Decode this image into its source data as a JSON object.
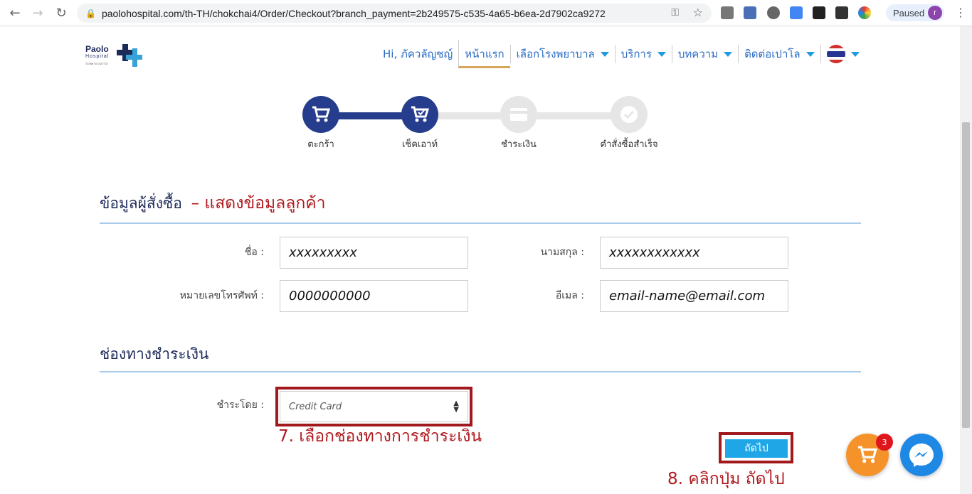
{
  "browser": {
    "url": "paolohospital.com/th-TH/chokchai4/Order/Checkout?branch_payment=2b249575-c535-4a65-b6ea-2d7902ca9272",
    "profile_status": "Paused",
    "profile_initial": "r"
  },
  "logo": {
    "line1": "Paolo",
    "line2": "Hospital",
    "line3": "โรงพยาบาลเปาโล"
  },
  "nav": {
    "greeting": "Hi, ภัควลัญชญ์",
    "home": "หน้าแรก",
    "hospital": "เลือกโรงพยาบาล",
    "services": "บริการ",
    "articles": "บทความ",
    "contact": "ติดต่อเปาโล"
  },
  "steps": [
    {
      "label": "ตะกร้า",
      "state": "done"
    },
    {
      "label": "เช็คเอาท์",
      "state": "current"
    },
    {
      "label": "ชำระเงิน",
      "state": "pending"
    },
    {
      "label": "คำสั่งซื้อสำเร็จ",
      "state": "pending"
    }
  ],
  "buyer_section": {
    "title": "ข้อมูลผู้สั่งซื้อ",
    "annotation": "– แสดงข้อมูลลูกค้า",
    "first_name_label": "ชื่อ :",
    "first_name_value": "xxxxxxxxx",
    "last_name_label": "นามสกุล :",
    "last_name_value": "xxxxxxxxxxxx",
    "phone_label": "หมายเลขโทรศัพท์ :",
    "phone_value": "0000000000",
    "email_label": "อีเมล :",
    "email_value": "email-name@email.com"
  },
  "payment_section": {
    "title": "ช่องทางชำระเงิน",
    "pay_by_label": "ชำระโดย :",
    "selected_method": "Credit Card",
    "annotation": "7. เลือกช่องทางการชำระเงิน"
  },
  "next_button": {
    "label": "ถัดไป",
    "annotation": "8. คลิกปุ่ม ถัดไป"
  },
  "cart_badge": "3",
  "colors": {
    "navy": "#1d2b58",
    "nav_link": "#2a6cc4",
    "annotation_red": "#b0191e",
    "button_blue": "#1ea6e6",
    "cart_orange": "#f5922a",
    "messenger_blue": "#1e88e5"
  }
}
